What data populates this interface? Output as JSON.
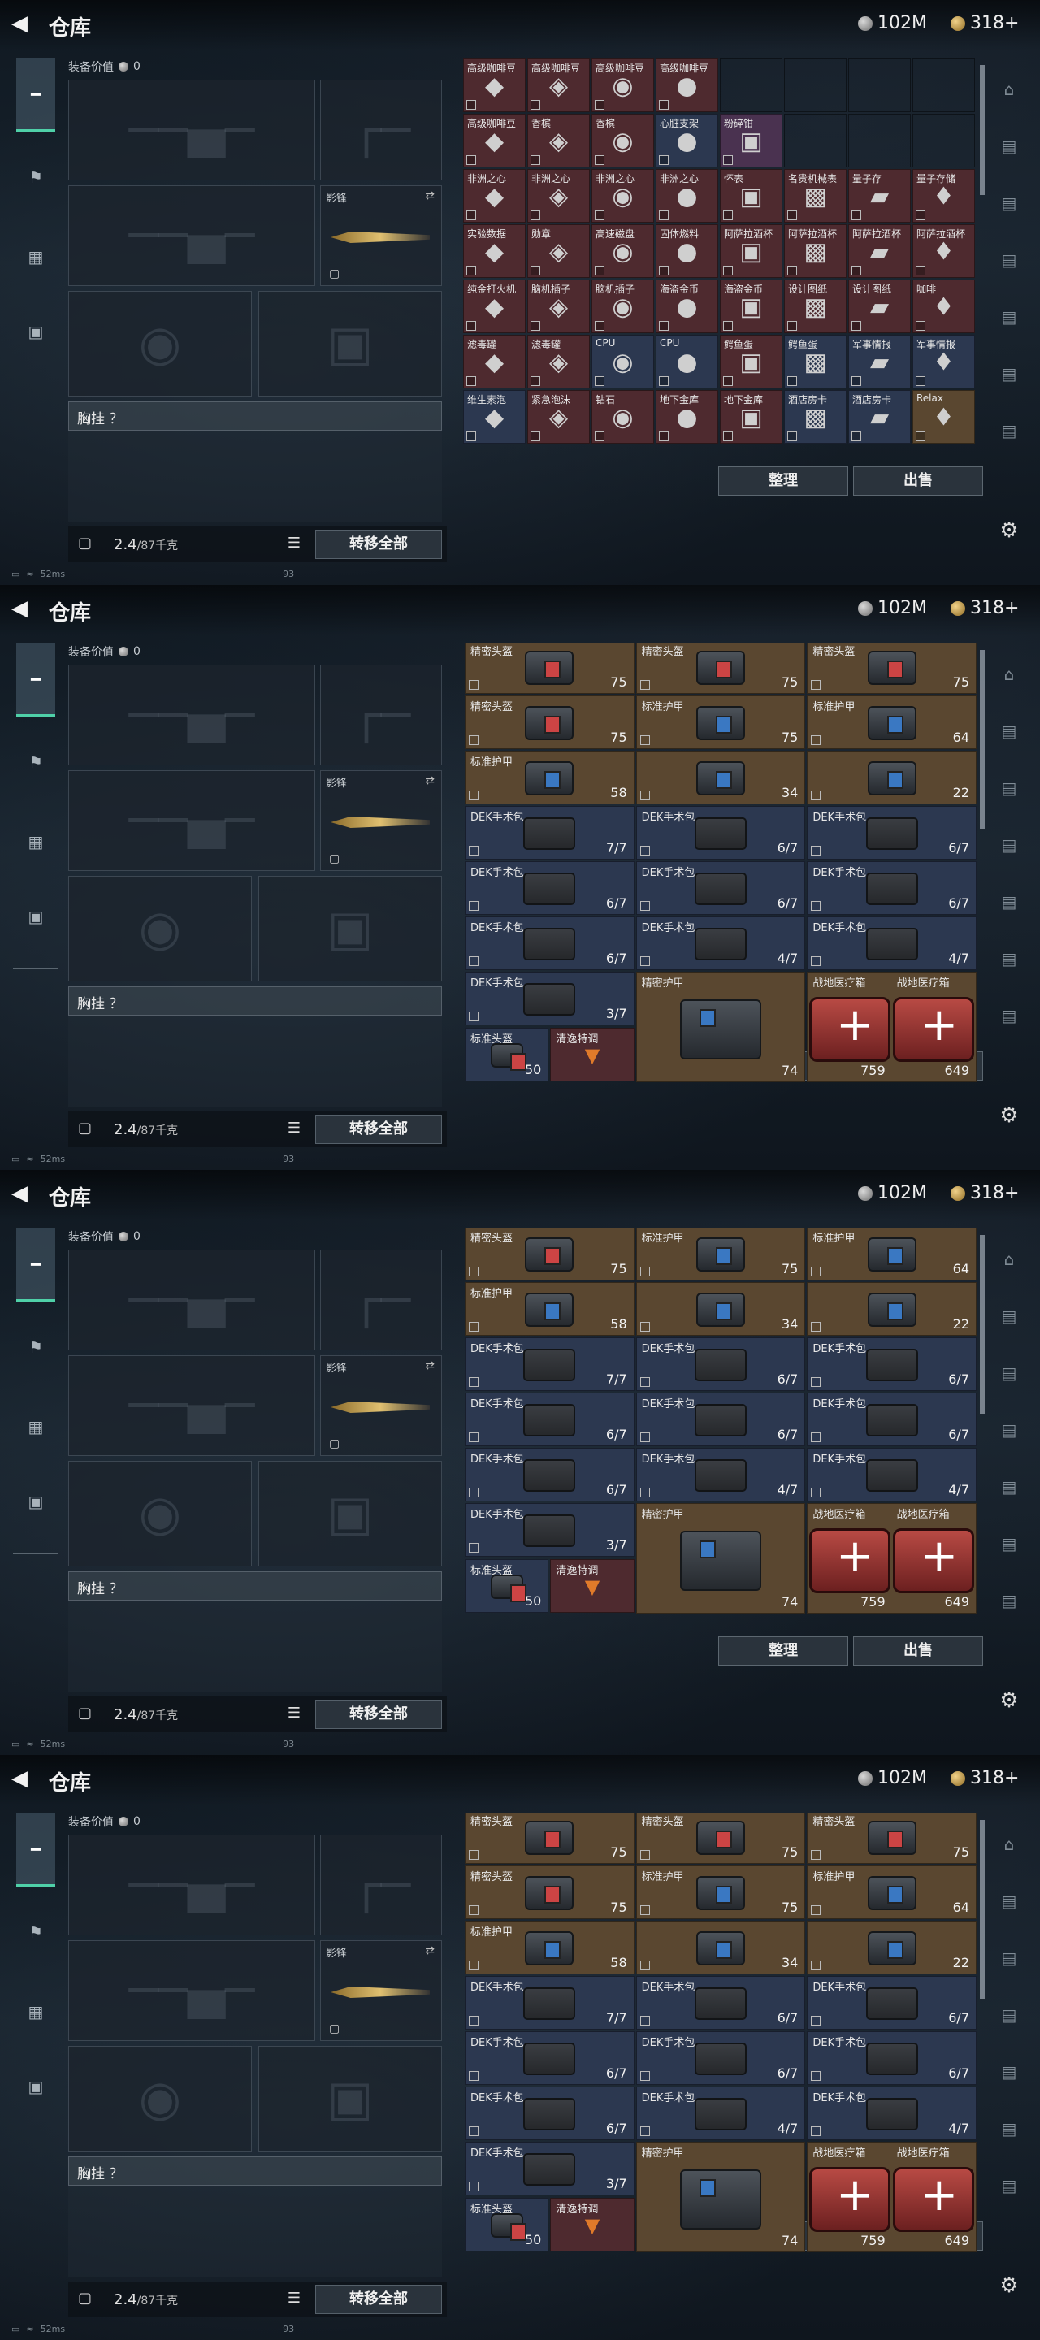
{
  "title": "仓库",
  "currency": {
    "silver": "102M",
    "gold": "318+"
  },
  "equip": {
    "value_label": "装备价值",
    "value": "0",
    "melee_label": "影锋",
    "chest_label": "胸挂 ？",
    "weight": "2.4",
    "weight_max": "/87千克",
    "transfer_label": "转移全部"
  },
  "buttons": {
    "sort": "整理",
    "sell": "出售"
  },
  "status": {
    "ping": "52ms",
    "fps": "93"
  },
  "frame1": {
    "cells": [
      [
        "高级咖啡豆",
        "r"
      ],
      [
        "高级咖啡豆",
        "r"
      ],
      [
        "高级咖啡豆",
        "r"
      ],
      [
        "高级咖啡豆",
        "r"
      ],
      [
        "",
        ""
      ],
      [
        "",
        ""
      ],
      [
        "",
        ""
      ],
      [
        "",
        ""
      ],
      [
        "高级咖啡豆",
        "r"
      ],
      [
        "香槟",
        "r"
      ],
      [
        "香槟",
        "r"
      ],
      [
        "心脏支架",
        "b"
      ],
      [
        "粉碎钳",
        "p"
      ],
      [
        "",
        ""
      ],
      [
        "",
        ""
      ],
      [
        "",
        ""
      ],
      [
        "非洲之心",
        "r"
      ],
      [
        "非洲之心",
        "r"
      ],
      [
        "非洲之心",
        "r"
      ],
      [
        "非洲之心",
        "r"
      ],
      [
        "怀表",
        "r"
      ],
      [
        "名贵机械表",
        "r"
      ],
      [
        "量子存",
        "r"
      ],
      [
        "量子存储",
        "r"
      ],
      [
        "实验数据",
        "r"
      ],
      [
        "勋章",
        "r"
      ],
      [
        "高速磁盘",
        "r"
      ],
      [
        "固体燃料",
        "r"
      ],
      [
        "阿萨拉酒杯",
        "r"
      ],
      [
        "阿萨拉酒杯",
        "r"
      ],
      [
        "阿萨拉酒杯",
        "r"
      ],
      [
        "阿萨拉酒杯",
        "r"
      ],
      [
        "纯金打火机",
        "r"
      ],
      [
        "脑机插子",
        "r"
      ],
      [
        "脑机插子",
        "r"
      ],
      [
        "海盗金币",
        "r"
      ],
      [
        "海盗金币",
        "r"
      ],
      [
        "设计图纸",
        "r"
      ],
      [
        "设计图纸",
        "r"
      ],
      [
        "咖啡",
        "r"
      ],
      [
        "滤毒罐",
        "r"
      ],
      [
        "滤毒罐",
        "r"
      ],
      [
        "CPU",
        "b"
      ],
      [
        "CPU",
        "b"
      ],
      [
        "鳄鱼蛋",
        "r"
      ],
      [
        "鳄鱼蛋",
        "b"
      ],
      [
        "军事情报",
        "b"
      ],
      [
        "军事情报",
        "b"
      ],
      [
        "维生素泡",
        "b"
      ],
      [
        "紧急泡沫",
        "r"
      ],
      [
        "钻石",
        "r"
      ],
      [
        "地下金库",
        "r"
      ],
      [
        "地下金库",
        "r"
      ],
      [
        "酒店房卡",
        "b"
      ],
      [
        "酒店房卡",
        "b"
      ],
      [
        "Relax",
        "g"
      ]
    ]
  },
  "big_rows": [
    {
      "cols": [
        [
          "精密头盔",
          "75",
          "helm"
        ],
        [
          "精密头盔",
          "75",
          "helm"
        ],
        [
          "精密头盔",
          "75",
          "helm"
        ]
      ]
    },
    {
      "cols": [
        [
          "精密头盔",
          "75",
          "helm"
        ],
        [
          "标准护甲",
          "75",
          "vest"
        ],
        [
          "标准护甲",
          "64",
          "vest"
        ]
      ]
    },
    {
      "cols": [
        [
          "标准护甲",
          "58",
          "vest"
        ],
        [
          "",
          "34",
          "vest"
        ],
        [
          "",
          "22",
          "vest"
        ]
      ]
    },
    {
      "cols": [
        [
          "DEK手术包",
          "7/7",
          "kit"
        ],
        [
          "DEK手术包",
          "6/7",
          "kit"
        ],
        [
          "DEK手术包",
          "6/7",
          "kit"
        ]
      ]
    },
    {
      "cols": [
        [
          "DEK手术包",
          "6/7",
          "kit"
        ],
        [
          "DEK手术包",
          "6/7",
          "kit"
        ],
        [
          "DEK手术包",
          "6/7",
          "kit"
        ]
      ]
    },
    {
      "cols": [
        [
          "DEK手术包",
          "6/7",
          "kit"
        ],
        [
          "DEK手术包",
          "4/7",
          "kit"
        ],
        [
          "DEK手术包",
          "4/7",
          "kit"
        ]
      ]
    }
  ],
  "last": {
    "dek": "DEK手术包",
    "dek_val": "3/7",
    "vest_name": "精密护甲",
    "vest_val": "74",
    "med1_name": "战地医疗箱",
    "med1_val": "759",
    "med2_name": "战地医疗箱",
    "med2_val": "649",
    "small1_name": "标准头盔",
    "small1_val": "50",
    "small2_name": "清逸特调"
  }
}
